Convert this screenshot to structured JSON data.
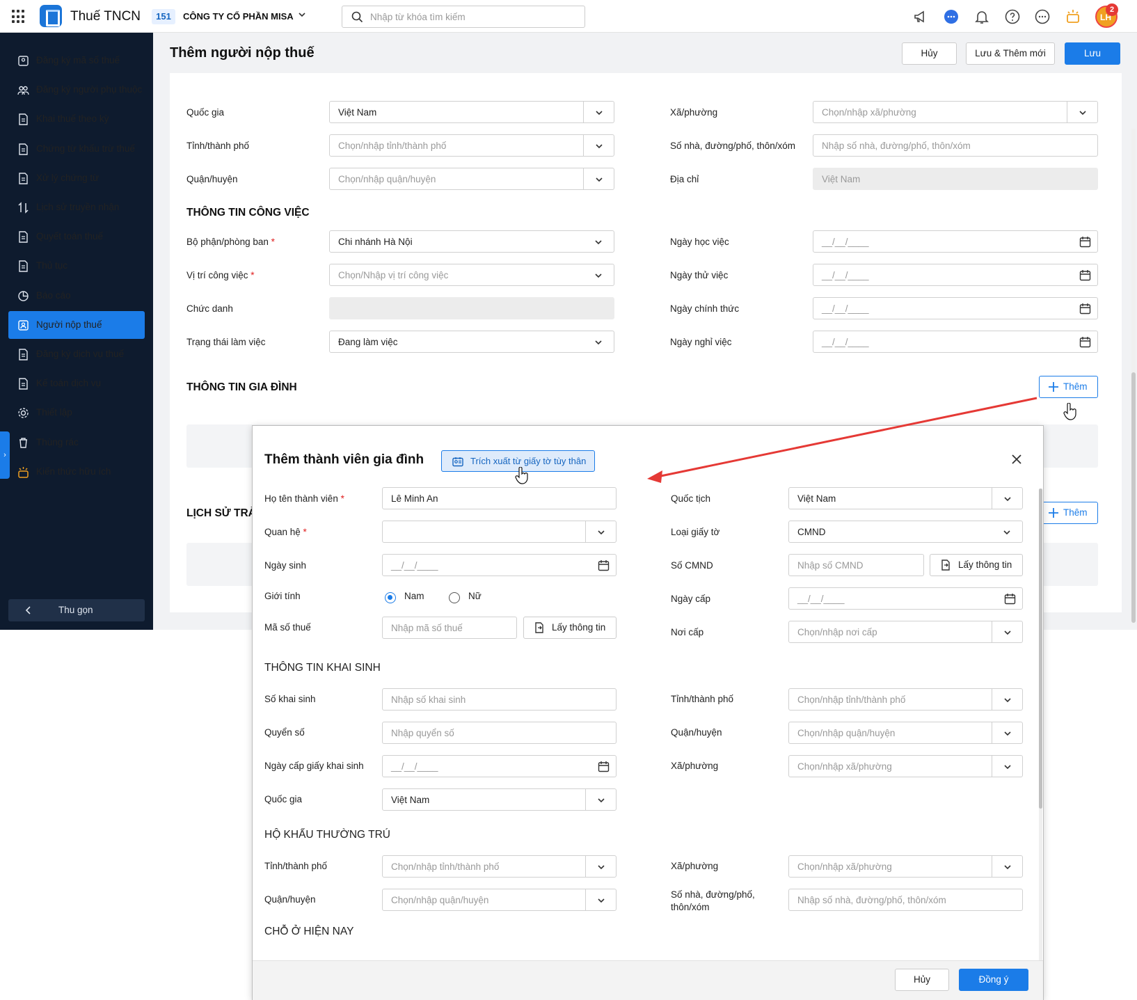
{
  "app": {
    "title": "Thuế TNCN",
    "company_code": "151",
    "company_name": "CÔNG TY CỔ PHẦN MISA",
    "search_placeholder": "Nhập từ khóa tìm kiếm",
    "avatar_initials": "LH",
    "notification_count": "2"
  },
  "sidebar": {
    "items": [
      {
        "label": "Đăng ký mã số thuế",
        "icon": "id-scan-icon"
      },
      {
        "label": "Đăng ký người phụ thuộc",
        "icon": "people-icon"
      },
      {
        "label": "Khai thuế theo kỳ",
        "icon": "document-icon"
      },
      {
        "label": "Chứng từ khấu trừ thuế",
        "icon": "receipt-icon"
      },
      {
        "label": "Xử lý chứng từ",
        "icon": "document-check-icon"
      },
      {
        "label": "Lịch sử truyền nhận",
        "icon": "transfer-icon"
      },
      {
        "label": "Quyết toán thuế",
        "icon": "settlement-icon"
      },
      {
        "label": "Thủ tục",
        "icon": "folder-icon"
      },
      {
        "label": "Báo cáo",
        "icon": "pie-chart-icon"
      },
      {
        "label": "Người nộp thuế",
        "icon": "person-card-icon"
      },
      {
        "label": "Đăng ký dịch vụ thuế",
        "icon": "service-icon"
      },
      {
        "label": "Kế toán dịch vụ",
        "icon": "accounting-icon"
      },
      {
        "label": "Thiết lập",
        "icon": "gear-icon"
      },
      {
        "label": "Thùng rác",
        "icon": "trash-icon"
      },
      {
        "label": "Kiến thức hữu ích",
        "icon": "knowledge-icon"
      }
    ],
    "active_index": 9,
    "collapse_label": "Thu gọn"
  },
  "page": {
    "title": "Thêm người nộp thuế",
    "cancel": "Hủy",
    "save_add": "Lưu & Thêm mới",
    "save": "Lưu"
  },
  "address": {
    "country_label": "Quốc gia",
    "country_value": "Việt Nam",
    "province_label": "Tỉnh/thành phố",
    "province_ph": "Chọn/nhập tỉnh/thành phố",
    "district_label": "Quận/huyện",
    "district_ph": "Chọn/nhập quận/huyện",
    "ward_label": "Xã/phường",
    "ward_ph": "Chọn/nhập xã/phường",
    "street_label": "Số nhà, đường/phố, thôn/xóm",
    "street_ph": "Nhập số nhà, đường/phố, thôn/xóm",
    "address_label": "Địa chỉ",
    "address_value": "Việt Nam"
  },
  "work": {
    "section": "THÔNG TIN CÔNG VIỆC",
    "dept_label": "Bộ phận/phòng ban",
    "dept_value": "Chi nhánh Hà Nội",
    "position_label": "Vị trí công việc",
    "position_ph": "Chọn/Nhập vị trí công việc",
    "title_label": "Chức danh",
    "status_label": "Trạng thái làm việc",
    "status_value": "Đang làm việc",
    "apprentice_label": "Ngày học việc",
    "probation_label": "Ngày thử việc",
    "official_label": "Ngày chính thức",
    "leave_label": "Ngày nghỉ việc",
    "date_ph": "__/__/____"
  },
  "family": {
    "section": "THÔNG TIN GIA ĐÌNH",
    "add": "Thêm"
  },
  "history": {
    "section": "LỊCH SỬ TRẢ",
    "add": "Thêm"
  },
  "modal": {
    "title": "Thêm thành viên gia đình",
    "extract": "Trích xuất từ giấy tờ tùy thân",
    "name_label": "Họ tên thành viên",
    "name_value": "Lê Minh An",
    "relation_label": "Quan hệ",
    "dob_label": "Ngày sinh",
    "date_ph": "__/__/____",
    "gender_label": "Giới tính",
    "male": "Nam",
    "female": "Nữ",
    "tax_label": "Mã số thuế",
    "tax_ph": "Nhập mã số thuế",
    "get_info": "Lấy thông tin",
    "nationality_label": "Quốc tịch",
    "nationality_value": "Việt Nam",
    "doctype_label": "Loại giấy tờ",
    "doctype_value": "CMND",
    "idno_label": "Số CMND",
    "idno_ph": "Nhập số CMND",
    "issue_date_label": "Ngày cấp",
    "issue_place_label": "Nơi cấp",
    "issue_place_ph": "Chọn/nhập nơi cấp",
    "birth_section": "THÔNG TIN KHAI SINH",
    "birth_no_label": "Số khai sinh",
    "birth_no_ph": "Nhập số khai sinh",
    "book_label": "Quyển số",
    "book_ph": "Nhập quyển số",
    "birth_date_label": "Ngày cấp giấy khai sinh",
    "country_label": "Quốc gia",
    "country_value": "Việt Nam",
    "province_label": "Tỉnh/thành phố",
    "province_ph": "Chọn/nhập tỉnh/thành phố",
    "district_label": "Quận/huyện",
    "district_ph": "Chọn/nhập quận/huyện",
    "ward_label": "Xã/phường",
    "ward_ph": "Chọn/nhập xã/phường",
    "residence_section": "HỘ KHẨU THƯỜNG TRÚ",
    "street_label_1": "Số nhà, đường/phố,",
    "street_label_2": "thôn/xóm",
    "street_ph": "Nhập số nhà, đường/phố, thôn/xóm",
    "current_section": "CHỖ Ở HIỆN NAY",
    "cancel": "Hủy",
    "ok": "Đồng ý"
  },
  "colors": {
    "primary": "#1b7ce8",
    "sidebar_bg": "#0e1b2e",
    "annotation_arrow": "#e53935"
  }
}
